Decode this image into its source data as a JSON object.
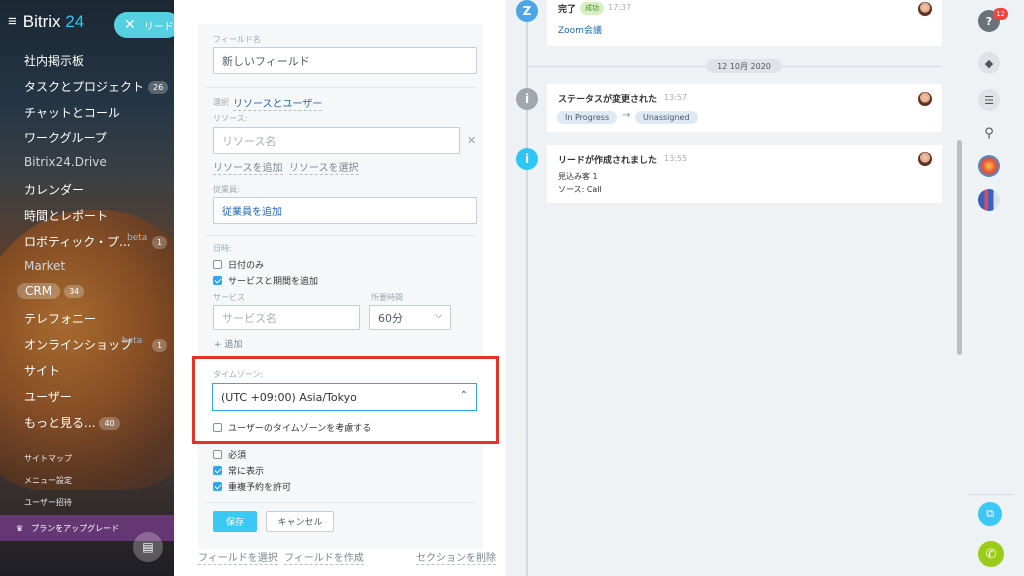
{
  "sidebar": {
    "logo_brand": "Bitrix",
    "logo_number": "24",
    "lead_button_label": "リード",
    "items": [
      {
        "label": "社内掲示板",
        "counter": ""
      },
      {
        "label": "タスクとプロジェクト",
        "counter": "26"
      },
      {
        "label": "チャットとコール",
        "counter": ""
      },
      {
        "label": "ワークグループ",
        "counter": ""
      },
      {
        "label": "Bitrix24.Drive",
        "counter": ""
      },
      {
        "label": "カレンダー",
        "counter": ""
      },
      {
        "label": "時間とレポート",
        "counter": ""
      },
      {
        "label": "ロボティック・プ...",
        "counter": "1",
        "beta": "beta"
      },
      {
        "label": "Market",
        "counter": ""
      },
      {
        "label": "CRM",
        "counter": "34"
      },
      {
        "label": "テレフォニー",
        "counter": ""
      },
      {
        "label": "オンラインショップ",
        "counter": "1",
        "beta": "beta"
      },
      {
        "label": "サイト",
        "counter": ""
      },
      {
        "label": "ユーザー",
        "counter": ""
      },
      {
        "label": "もっと見る...",
        "counter": "40"
      }
    ],
    "small_items": [
      "サイトマップ",
      "メニュー設定",
      "ユーザー招待"
    ],
    "upgrade_label": "プランをアップグレード"
  },
  "form": {
    "field_name_label": "フィールド名",
    "field_name_value": "新しいフィールド",
    "select_prefix": "選択",
    "select_link": "リソースとユーザー",
    "resource_label": "リソース:",
    "resource_placeholder": "リソース名",
    "add_resource": "リソースを追加",
    "select_resource": "リソースを選択",
    "employee_label": "従業員:",
    "add_employee": "従業員を追加",
    "datetime_label": "日時:",
    "date_only": "日付のみ",
    "add_service": "サービスと期間を追加",
    "service_label": "サービス",
    "service_placeholder": "サービス名",
    "duration_label": "所要時間",
    "duration_value": "60分",
    "add_more": "+ 追加",
    "timezone_label": "タイムゾーン:",
    "timezone_value": "(UTC +09:00) Asia/Tokyo",
    "consider_user_tz": "ユーザーのタイムゾーンを考慮する",
    "required": "必須",
    "always_show": "常に表示",
    "allow_overbooking": "重複予約を許可",
    "save": "保存",
    "cancel": "キャンセル",
    "select_field": "フィールドを選択",
    "create_field": "フィールドを作成",
    "delete_section": "セクションを削除"
  },
  "timeline": {
    "card1": {
      "title": "完了",
      "badge": "成功",
      "time": "17:37",
      "link": "Zoom会議"
    },
    "date_divider": "12 10月 2020",
    "card2": {
      "title": "ステータスが変更された",
      "time": "13:57",
      "from": "In Progress",
      "arrow": "→",
      "to": "Unassigned"
    },
    "card3": {
      "title": "リードが作成されました",
      "time": "13:55",
      "line1": "見込み客 1",
      "line2": "ソース: Call"
    }
  },
  "rail": {
    "help_badge": "12"
  },
  "colors": {
    "accent": "#2fc6f6",
    "highlight": "#e63226",
    "link": "#2067b0"
  }
}
